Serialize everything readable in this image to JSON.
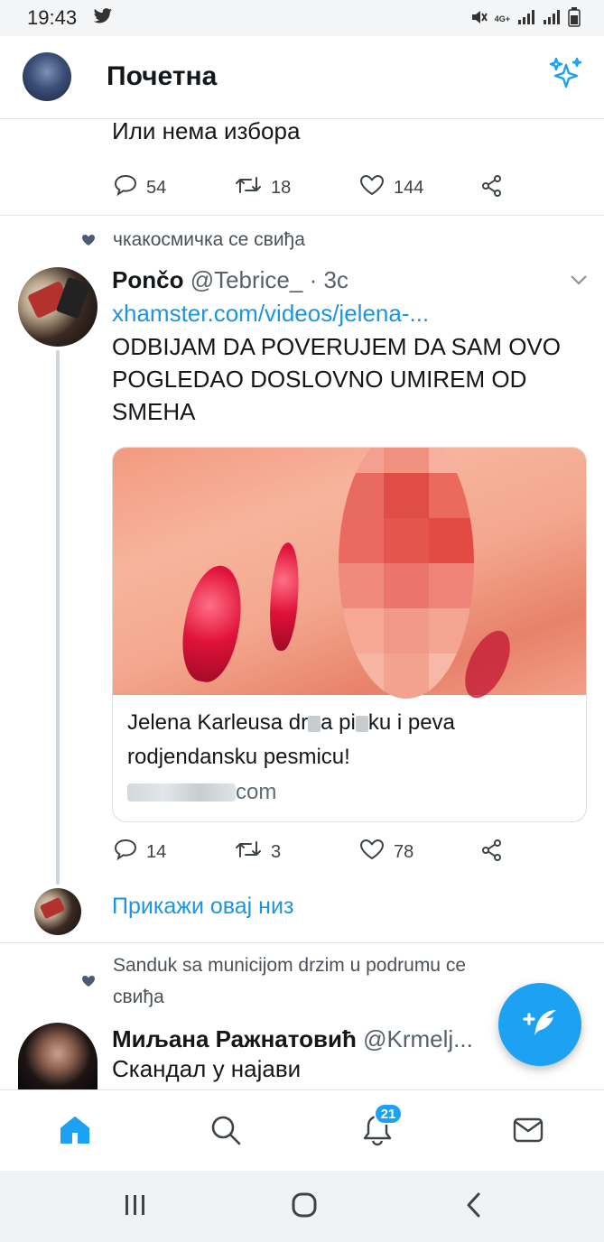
{
  "status_bar": {
    "time": "19:43",
    "network": "4G+"
  },
  "header": {
    "title": "Почетна"
  },
  "tweet1": {
    "text": "Или нема избора",
    "replies": "54",
    "retweets": "18",
    "likes": "144"
  },
  "tweet2": {
    "social_context": "чкакосмичка се свиђа",
    "author_name": "Pončo",
    "author_handle": "@Tebrice_",
    "time": "· 3с",
    "link": "xhamster.com/videos/jelena-...",
    "text_line1": "ODBIJAM DA POVERUJEM DA SAM OVO",
    "text_line2": "POGLEDAO DOSLOVNO UMIREM OD",
    "text_line3": "SMEHA",
    "card": {
      "title_part1": "Jelena Karleusa dr",
      "title_part2": "a pi",
      "title_part3": "ku i peva",
      "title_line2": "rodjendansku pesmicu!",
      "domain": "com"
    },
    "replies": "14",
    "retweets": "3",
    "likes": "78"
  },
  "show_thread": {
    "label": "Прикажи овај низ"
  },
  "tweet3": {
    "social_context_line1": "Sanduk sa municijom drzim u podrumu ce",
    "social_context_line2": "свиђа",
    "author_name": "Миљана Ражнатовић",
    "author_handle": "@Krmelj...",
    "text": "Скандал у најави"
  },
  "bottom_nav": {
    "notifications_badge": "21"
  },
  "colors": {
    "accent": "#1da1f2",
    "link": "#1b95e0",
    "text": "#14171a",
    "muted": "#58616a"
  }
}
